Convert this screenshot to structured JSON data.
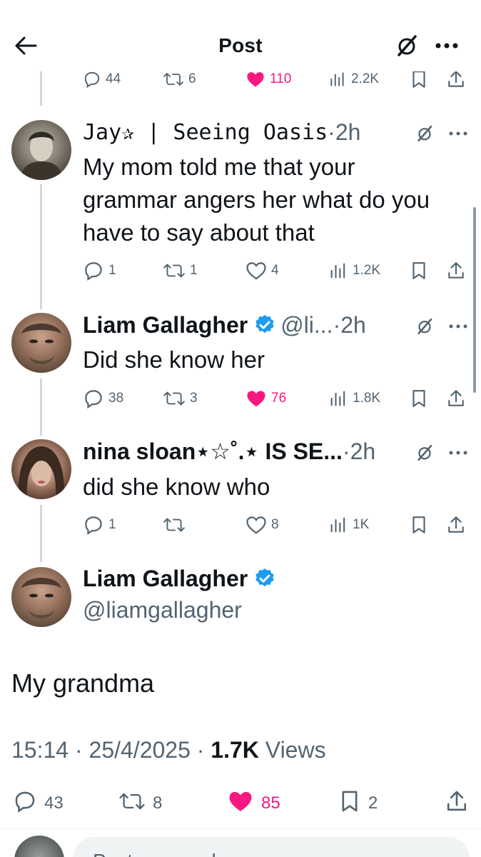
{
  "header": {
    "title": "Post"
  },
  "top_actions": {
    "replies": "44",
    "reposts": "6",
    "likes": "110",
    "views": "2.2K"
  },
  "replies": [
    {
      "name": "Jay✰ | Seeing Oasis",
      "handle": "",
      "time": "·2h",
      "text": "My mom told me that your grammar angers her what do you have to say about that",
      "replies": "1",
      "reposts": "1",
      "likes": "4",
      "views": "1.2K",
      "liked": false
    },
    {
      "name": "Liam Gallagher",
      "handle": "@li...",
      "time": "·2h",
      "text": "Did she know her",
      "replies": "38",
      "reposts": "3",
      "likes": "76",
      "views": "1.8K",
      "liked": true,
      "verified": true
    },
    {
      "name": "nina sloan⋆☆˚.⋆ IS SE...",
      "handle": "",
      "time": "·2h",
      "text": "did she know who",
      "replies": "1",
      "reposts": "",
      "likes": "8",
      "views": "1K",
      "liked": false
    }
  ],
  "main_tweet": {
    "name": "Liam Gallagher",
    "handle": "@liamgallagher",
    "text": "My grandma",
    "time": "15:14",
    "date": "25/4/2025",
    "views_count": "1.7K",
    "views_label": "Views",
    "replies": "43",
    "reposts": "8",
    "likes": "85",
    "bookmarks": "2"
  },
  "reply_box": {
    "placeholder": "Post your reply"
  },
  "colors": {
    "accent_pink": "#f91880",
    "verified_blue": "#1d9bf0",
    "muted": "#536471",
    "text": "#0f1419"
  },
  "icons": [
    "back-arrow-icon",
    "grok-icon",
    "more-icon",
    "reply-icon",
    "repost-icon",
    "like-icon",
    "views-icon",
    "bookmark-icon",
    "share-icon",
    "verified-icon"
  ]
}
